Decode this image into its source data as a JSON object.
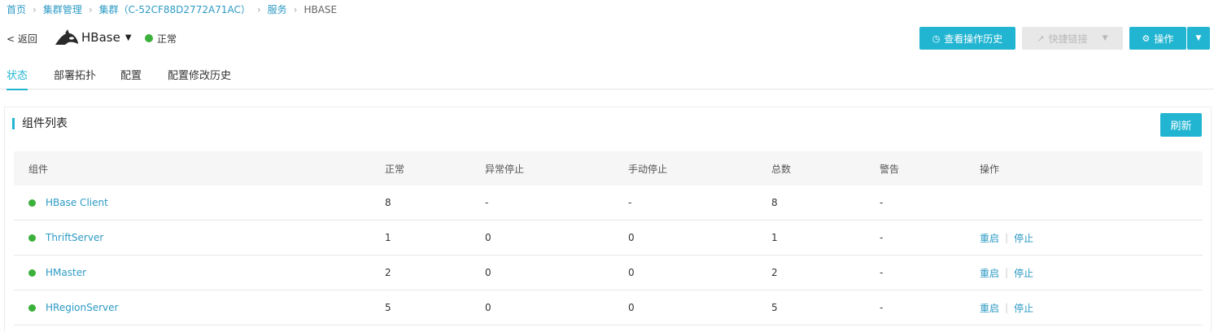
{
  "breadcrumb": {
    "home": "首页",
    "cluster_mgmt": "集群管理",
    "cluster": "集群（C-52CF88D2772A71AC）",
    "services": "服务",
    "current": "HBASE",
    "separator": "›"
  },
  "header": {
    "back": "< 返回",
    "service_name": "HBase",
    "status": "正常",
    "status_color": "#3bb03b"
  },
  "actions": {
    "history": "查看操作历史",
    "quick_links": "快捷链接",
    "operations": "操作"
  },
  "tabs": [
    "状态",
    "部署拓扑",
    "配置",
    "配置修改历史"
  ],
  "panel": {
    "title": "组件列表",
    "refresh": "刷新"
  },
  "table": {
    "headers": [
      "组件",
      "正常",
      "异常停止",
      "手动停止",
      "总数",
      "警告",
      "操作"
    ],
    "rows": [
      {
        "name": "HBase Client",
        "normal": "8",
        "abnormal": "-",
        "manual": "-",
        "total": "8",
        "warn": "-",
        "restart": "",
        "stop": ""
      },
      {
        "name": "ThriftServer",
        "normal": "1",
        "abnormal": "0",
        "manual": "0",
        "total": "1",
        "warn": "-",
        "restart": "重启",
        "stop": "停止"
      },
      {
        "name": "HMaster",
        "normal": "2",
        "abnormal": "0",
        "manual": "0",
        "total": "2",
        "warn": "-",
        "restart": "重启",
        "stop": "停止"
      },
      {
        "name": "HRegionServer",
        "normal": "5",
        "abnormal": "0",
        "manual": "0",
        "total": "5",
        "warn": "-",
        "restart": "重启",
        "stop": "停止"
      }
    ]
  },
  "colors": {
    "accent": "#22b5d2",
    "link": "#2c9ac4",
    "ok": "#3bb03b"
  }
}
